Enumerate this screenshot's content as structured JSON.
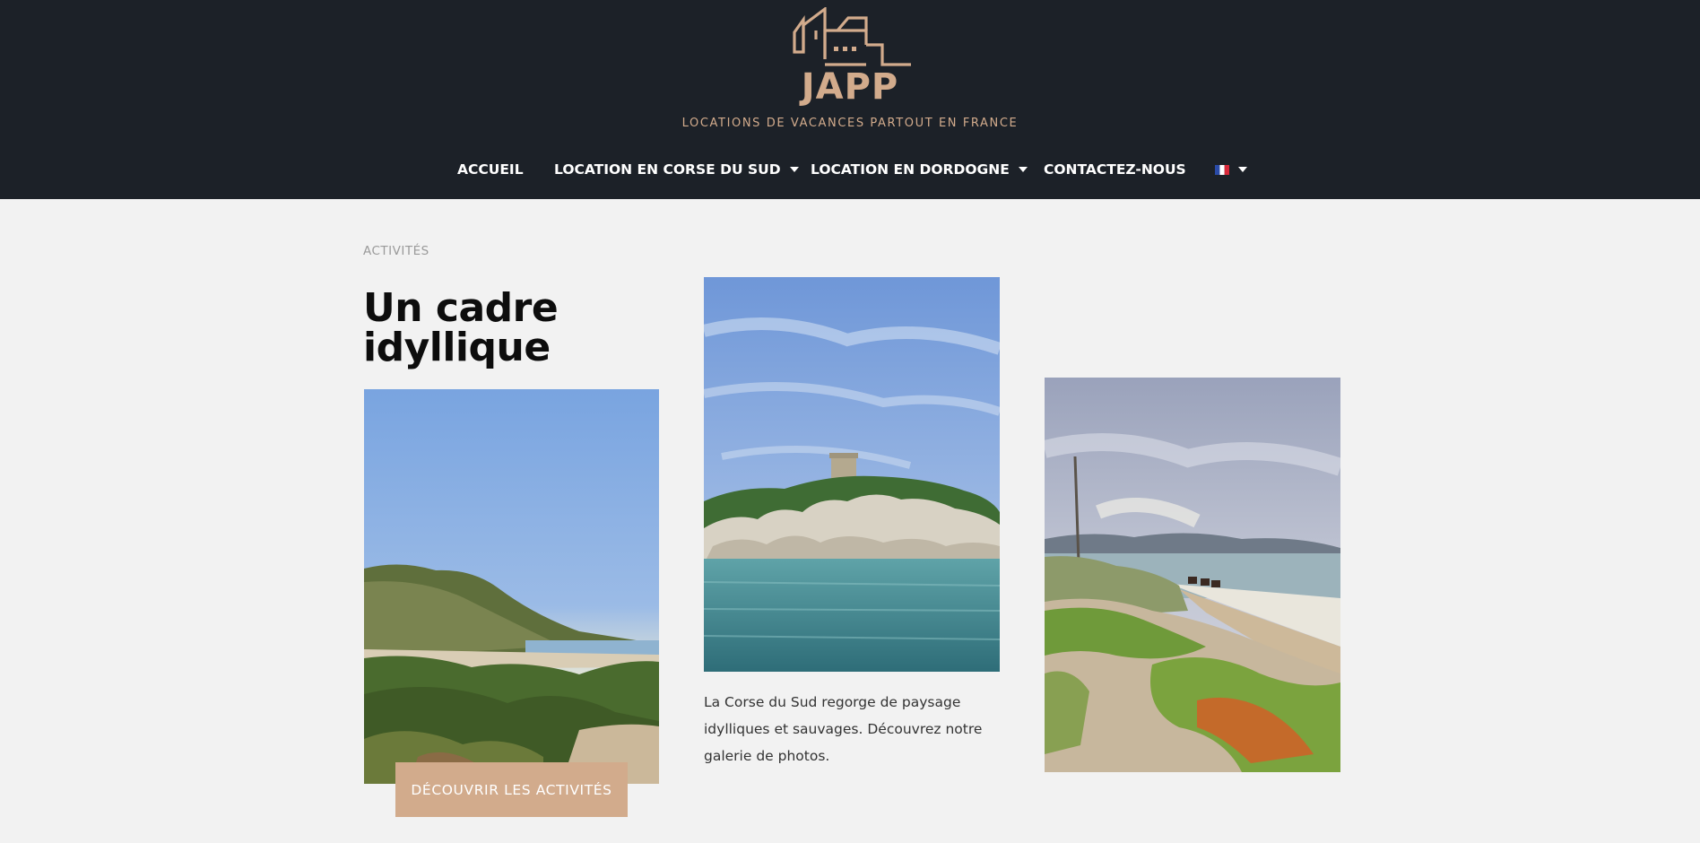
{
  "header": {
    "brand": "JAPP",
    "tagline": "LOCATIONS DE VACANCES PARTOUT EN FRANCE",
    "logo_icon": "house-outline-icon",
    "background_color": "#1c2128",
    "accent_color": "#d2ab8c"
  },
  "nav": {
    "items": [
      {
        "label": "ACCUEIL",
        "has_dropdown": false
      },
      {
        "label": "LOCATION EN CORSE DU SUD",
        "has_dropdown": true
      },
      {
        "label": "LOCATION EN DORDOGNE",
        "has_dropdown": true
      },
      {
        "label": "CONTACTEZ-NOUS",
        "has_dropdown": false
      }
    ],
    "language": {
      "icon": "french-flag-icon",
      "has_dropdown": true
    }
  },
  "main": {
    "eyebrow": "ACTIVITÉS",
    "title": "Un cadre idyllique",
    "cta_label": "DÉCOUVRIR LES ACTIVITÉS",
    "description": "La Corse du Sud regorge de paysage idylliques et sauvages. Découvrez notre galerie de photos.",
    "photos": [
      {
        "icon": "hillside-beach-photo"
      },
      {
        "icon": "rocky-tower-sea-photo"
      },
      {
        "icon": "beach-horses-photo"
      }
    ]
  }
}
